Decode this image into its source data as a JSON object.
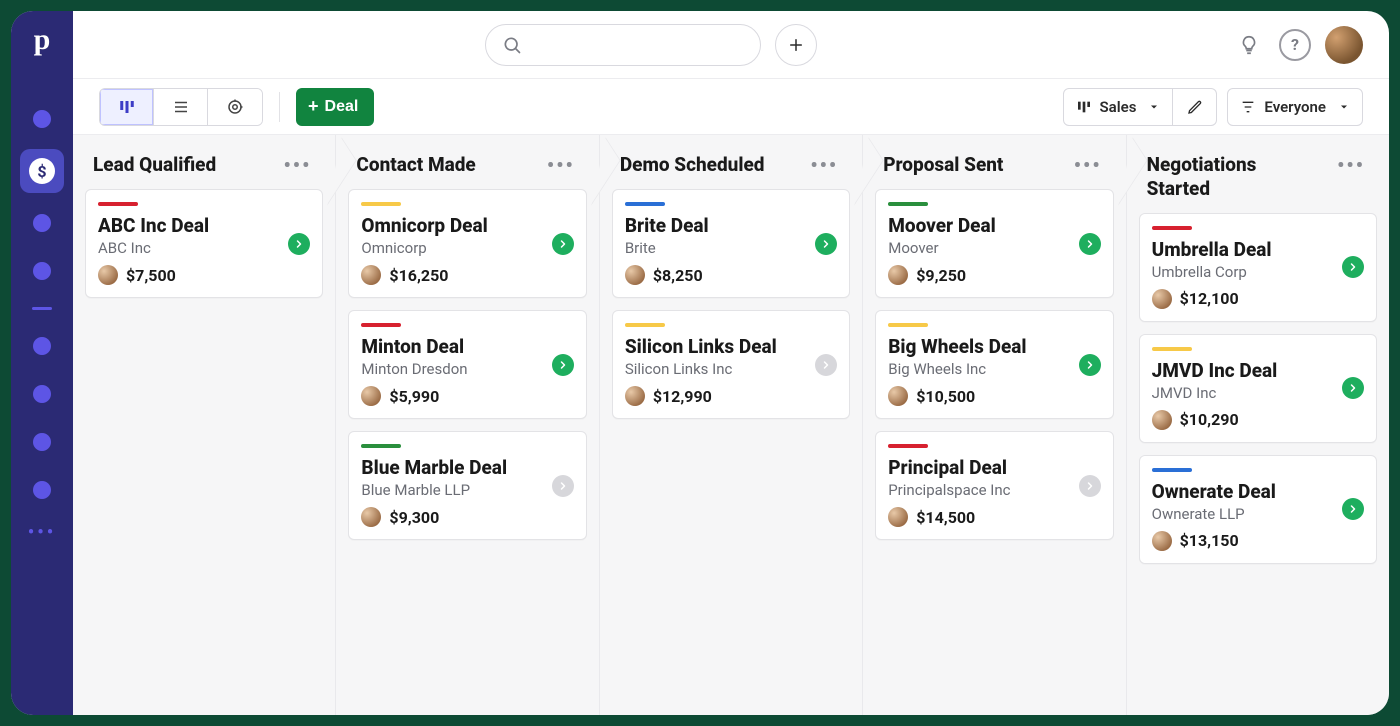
{
  "logo_letter": "p",
  "toolbar": {
    "add_deal_label": "Deal",
    "pipeline_label": "Sales",
    "filter_label": "Everyone"
  },
  "columns": [
    {
      "title": "Lead Qualified",
      "cards": [
        {
          "stripe": "s-red",
          "title": "ABC Inc Deal",
          "subtitle": "ABC Inc",
          "amount": "$7,500",
          "go": "green"
        }
      ]
    },
    {
      "title": "Contact Made",
      "cards": [
        {
          "stripe": "s-yellow",
          "title": "Omnicorp Deal",
          "subtitle": "Omnicorp",
          "amount": "$16,250",
          "go": "green"
        },
        {
          "stripe": "s-red",
          "title": "Minton Deal",
          "subtitle": "Minton Dresdon",
          "amount": "$5,990",
          "go": "green"
        },
        {
          "stripe": "s-green",
          "title": "Blue Marble Deal",
          "subtitle": "Blue Marble LLP",
          "amount": "$9,300",
          "go": "grey"
        }
      ]
    },
    {
      "title": "Demo Scheduled",
      "cards": [
        {
          "stripe": "s-blue",
          "title": "Brite Deal",
          "subtitle": "Brite",
          "amount": "$8,250",
          "go": "green"
        },
        {
          "stripe": "s-yellow",
          "title": "Silicon Links Deal",
          "subtitle": "Silicon Links Inc",
          "amount": "$12,990",
          "go": "grey"
        }
      ]
    },
    {
      "title": "Proposal Sent",
      "cards": [
        {
          "stripe": "s-green",
          "title": "Moover Deal",
          "subtitle": "Moover",
          "amount": "$9,250",
          "go": "green"
        },
        {
          "stripe": "s-yellow",
          "title": "Big Wheels Deal",
          "subtitle": "Big Wheels Inc",
          "amount": "$10,500",
          "go": "green"
        },
        {
          "stripe": "s-red",
          "title": "Principal Deal",
          "subtitle": "Principalspace Inc",
          "amount": "$14,500",
          "go": "grey"
        }
      ]
    },
    {
      "title": "Negotiations Started",
      "cards": [
        {
          "stripe": "s-red",
          "title": "Umbrella Deal",
          "subtitle": "Umbrella Corp",
          "amount": "$12,100",
          "go": "green"
        },
        {
          "stripe": "s-yellow",
          "title": "JMVD Inc Deal",
          "subtitle": "JMVD Inc",
          "amount": "$10,290",
          "go": "green"
        },
        {
          "stripe": "s-blue",
          "title": "Ownerate Deal",
          "subtitle": "Ownerate LLP",
          "amount": "$13,150",
          "go": "green"
        }
      ]
    }
  ]
}
